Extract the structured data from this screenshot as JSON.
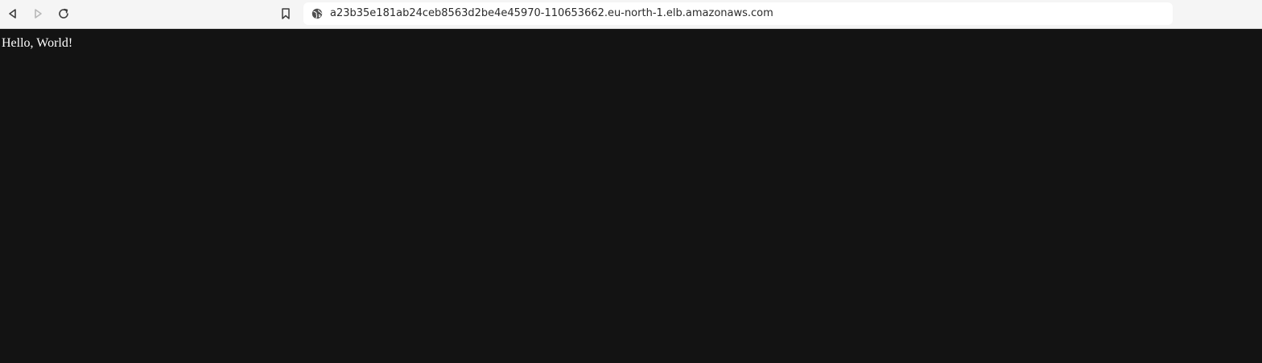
{
  "browser": {
    "url": "a23b35e181ab24ceb8563d2be4e45970-110653662.eu-north-1.elb.amazonaws.com",
    "icons": {
      "back": "back-arrow-icon",
      "forward": "forward-arrow-icon",
      "reload": "reload-icon",
      "bookmark": "bookmark-icon",
      "site": "globe-icon"
    },
    "forward_enabled": false
  },
  "page": {
    "text": "Hello, World!",
    "background": "#131313",
    "text_color": "#ffffff"
  }
}
